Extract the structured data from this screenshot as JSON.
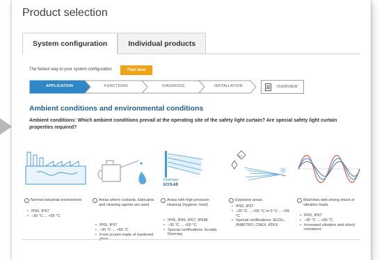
{
  "page": {
    "title": "Product selection"
  },
  "tabs": [
    {
      "label": "System configuration",
      "active": true
    },
    {
      "label": "Individual products",
      "active": false
    }
  ],
  "fast_lane": {
    "text": "The fastest way to your system configuration",
    "button_label": "Fast lane"
  },
  "steps": [
    {
      "label": "Application",
      "active": true
    },
    {
      "label": "Functions",
      "active": false
    },
    {
      "label": "Diagnosis",
      "active": false
    },
    {
      "label": "Installation",
      "active": false
    }
  ],
  "overview": {
    "label": "Overview"
  },
  "section": {
    "heading": "Ambient conditions and environmental conditions",
    "question": "Ambient conditions: Which ambient conditions prevail at the operating site of the safety light curtain? Are special safety light curtain properties required?"
  },
  "options": [
    {
      "label": "Normal industrial environment",
      "bullets": [
        "IP65, IP67",
        "–30 °C ... +55 °C"
      ],
      "icon": "factory-icon"
    },
    {
      "label": "Areas where coolants, lubricants and cleaning agents are used",
      "bullets": [
        "IP65, IP67",
        "–30 °C ... +55 °C",
        "Front screen made of hardened glass"
      ],
      "icon": "oil-can-icon"
    },
    {
      "label": "Areas with high pressure cleaning (hygiene, food)",
      "bullets": [
        "IP65, IP66, IP67, IP69K",
        "–30 °C ... +55 °C",
        "Special certifications: Ecolab, Diversey"
      ],
      "icon": "pressure-cleaning-icon",
      "logos": [
        "Diversey",
        "ECOLAB"
      ]
    },
    {
      "label": "Explosive areas",
      "bullets": [
        "IP65, IP67",
        "–20 °C ... +55 °C or 0 °C ... +55 °C",
        "Special certifications: IECEx, INMETRO, CNEX, ATEX"
      ],
      "icon": "explosion-protection-icon"
    },
    {
      "label": "Machines with strong shock or vibration loads",
      "bullets": [
        "IP65, IP67",
        "–30 °C ... +55 °C",
        "Increased vibration and shock resistance"
      ],
      "icon": "vibration-wave-icon"
    }
  ],
  "colors": {
    "accent_blue": "#1f5f8f",
    "step_active": "#2f87c8",
    "fast_lane": "#f0a316",
    "icon_blue": "#3f9ad8"
  }
}
